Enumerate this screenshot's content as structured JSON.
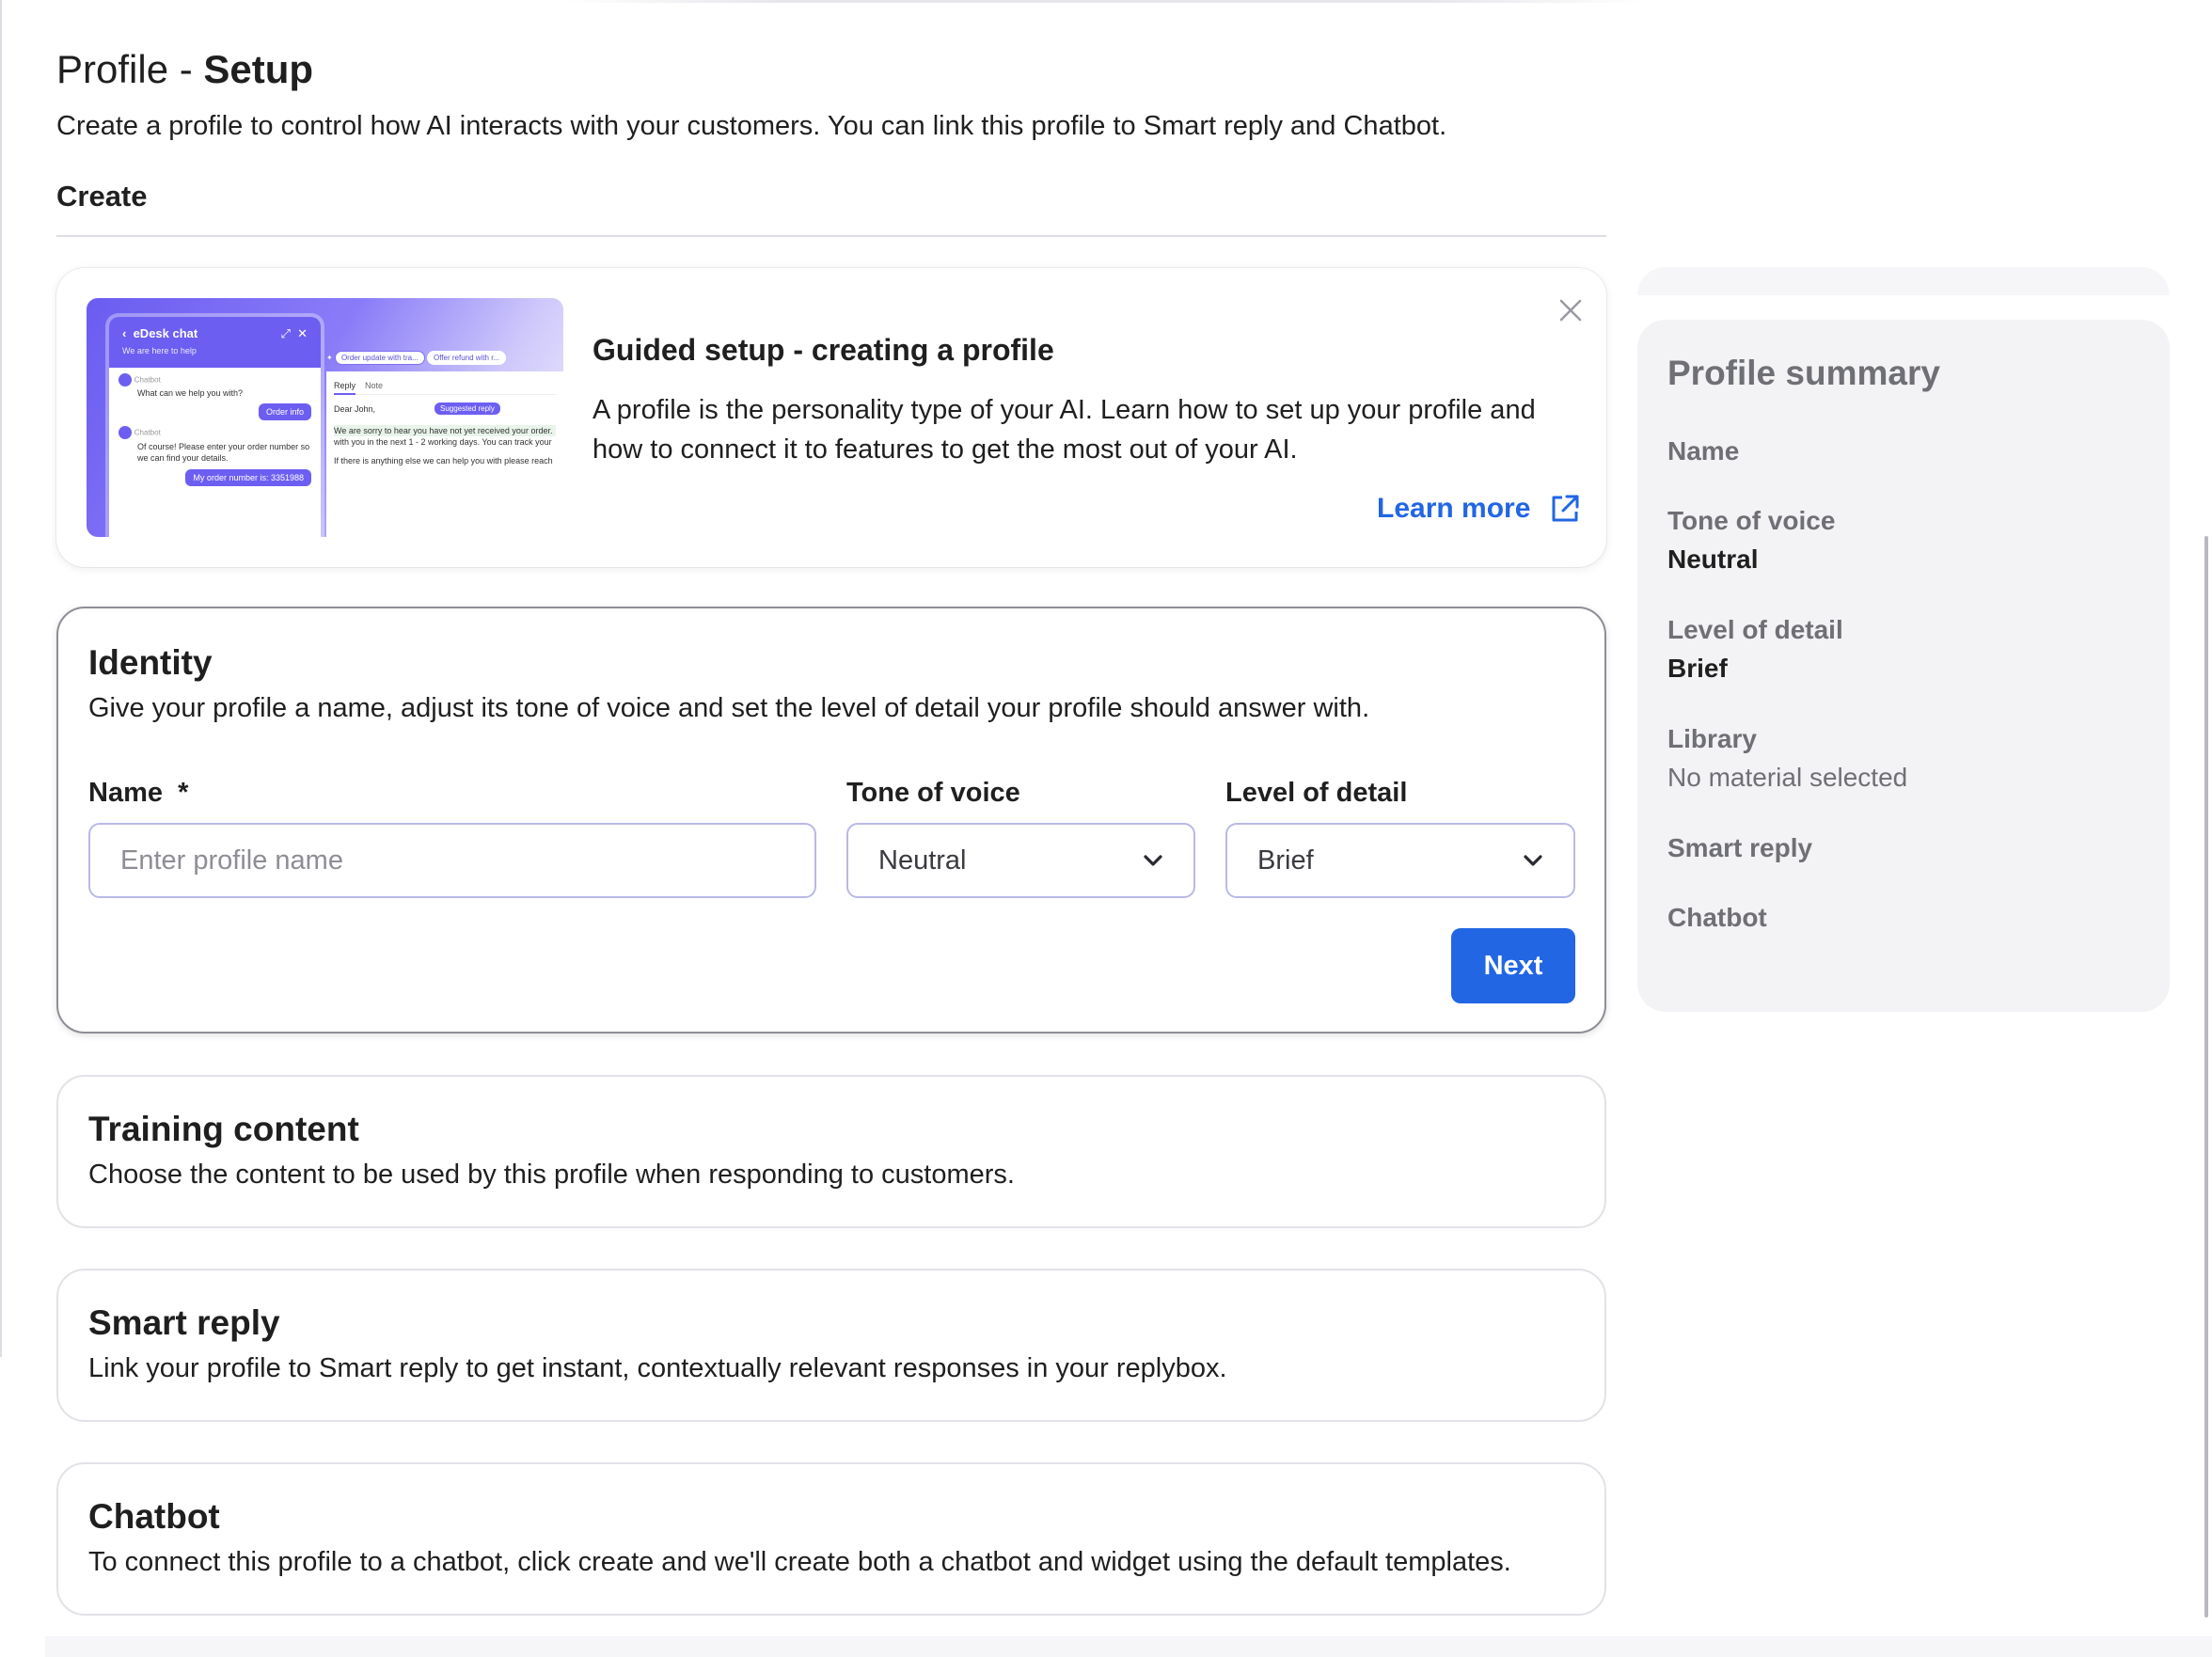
{
  "header": {
    "title_prefix": "Profile - ",
    "title_bold": "Setup",
    "subtitle": "Create a profile to control how AI interacts with your customers. You can link this profile to Smart reply and Chatbot.",
    "tab": "Create"
  },
  "guide": {
    "title": "Guided setup - creating a profile",
    "text": "A profile is the personality type of your AI. Learn how to set up your profile and how to connect it to features to get the most out of your AI.",
    "learn_more": "Learn more",
    "illustration": {
      "chat_title": "eDesk chat",
      "chat_subtitle": "We are here to help",
      "bot_label": "Chatbot",
      "msg1": "What can we help you with?",
      "btn_order": "Order info",
      "msg2": "Of course! Please enter your order number so we can find your details.",
      "user_msg": "My order number is: 3351988",
      "chip1": "Order update with tra...",
      "chip2": "Offer refund with r...",
      "suggested": "Suggested reply",
      "tab_reply": "Reply",
      "tab_note": "Note",
      "greeting": "Dear John,",
      "body1": "We are sorry to hear you have not yet received your order.",
      "body2": "with you in the next 1 - 2 working days. You can track your",
      "body3": "If there is anything else we can help you with please reach"
    }
  },
  "identity": {
    "title": "Identity",
    "description": "Give your profile a name, adjust its tone of voice and set the level of detail your profile should answer with.",
    "name_label": "Name",
    "required_mark": "*",
    "name_placeholder": "Enter profile name",
    "name_value": "",
    "tone_label": "Tone of voice",
    "tone_value": "Neutral",
    "detail_label": "Level of detail",
    "detail_value": "Brief",
    "next_label": "Next"
  },
  "sections": [
    {
      "title": "Training content",
      "description": "Choose the content to be used by this profile when responding to customers."
    },
    {
      "title": "Smart reply",
      "description": "Link your profile to Smart reply to get instant, contextually relevant responses in your replybox."
    },
    {
      "title": "Chatbot",
      "description": "To connect this profile to a chatbot, click create and we'll create both a chatbot and widget using the default templates."
    }
  ],
  "summary": {
    "title": "Profile summary",
    "name_label": "Name",
    "tone_label": "Tone of voice",
    "tone_value": "Neutral",
    "detail_label": "Level of detail",
    "detail_value": "Brief",
    "library_label": "Library",
    "library_value": "No material selected",
    "smart_reply_label": "Smart reply",
    "chatbot_label": "Chatbot"
  },
  "colors": {
    "accent": "#2266e3",
    "brand_purple": "#6d5ef2",
    "summary_bg": "#f3f3f5"
  },
  "icons": [
    "close-icon",
    "external-link-icon",
    "chevron-down-icon"
  ]
}
